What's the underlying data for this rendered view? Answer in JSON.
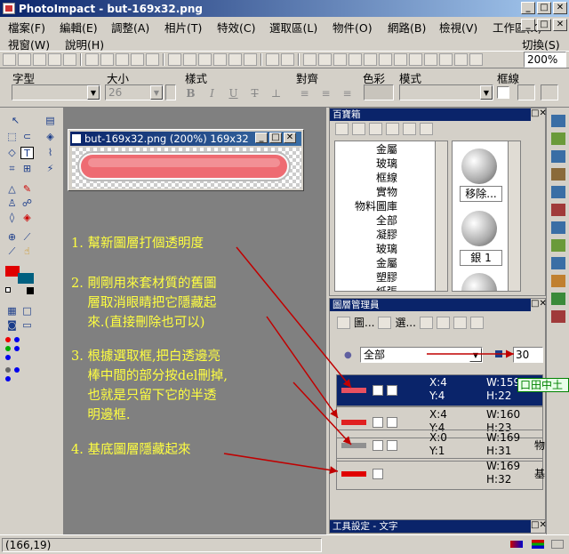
{
  "app": {
    "title": "PhotoImpact - but-169x32.png"
  },
  "menu": {
    "items": [
      "檔案(F)",
      "編輯(E)",
      "調整(A)",
      "相片(T)",
      "特效(C)",
      "選取區(L)",
      "物件(O)",
      "網路(B)",
      "檢視(V)",
      "工作區(K)"
    ],
    "row2": [
      "視窗(W)",
      "說明(H)"
    ],
    "toggle": "切換(S)"
  },
  "toolbar": {
    "zoom": "200%"
  },
  "props": {
    "font_label": "字型",
    "size_label": "大小",
    "style_label": "樣式",
    "align_label": "對齊",
    "color_label": "色彩",
    "mode_label": "模式",
    "border_label": "框線",
    "size_value": "26"
  },
  "document": {
    "title": "but-169x32.png (200%) 169x32",
    "background": "#808080",
    "button_color": "#ee6b72"
  },
  "annotations": [
    "1. 幫新圖層打個透明度",
    "2. 剛剛用來套材質的舊圖\n    層取消眼睛把它隱藏起\n    來.(直接刪除也可以)",
    "3. 根據選取框,把白透邊亮\n    棒中間的部分按del刪掉,\n    也就是只留下它的半透\n    明邊框.",
    "4. 基底圖層隱藏起來"
  ],
  "treasure": {
    "title": "百寶箱",
    "tree": [
      "金屬",
      "玻璃",
      "框線",
      "實物",
      "物料圖庫",
      "全部",
      "凝膠",
      "玻璃",
      "金屬",
      "塑膠",
      "紙張"
    ],
    "thumb_labels": [
      "移除...",
      "銀 1"
    ]
  },
  "layers": {
    "title": "圖層管理員",
    "tab1": "圖...",
    "tab2": "選...",
    "filter": "全部",
    "opacity": "30",
    "rows": [
      {
        "xy": [
          "X:4",
          "Y:4"
        ],
        "wh": [
          "W:159",
          "H:22"
        ],
        "extra": "",
        "swatch": "#e85060"
      },
      {
        "xy": [
          "X:4",
          "Y:4"
        ],
        "wh": [
          "W:160",
          "H:23"
        ],
        "extra": "",
        "swatch": "#e02020"
      },
      {
        "xy": [
          "X:0",
          "Y:1"
        ],
        "wh": [
          "W:169",
          "H:31"
        ],
        "extra": "物",
        "swatch": "#909090"
      },
      {
        "xy": [
          "",
          ""
        ],
        "wh": [
          "W:169",
          "H:32"
        ],
        "extra": "基",
        "swatch": "#e00000"
      }
    ]
  },
  "textpanel": {
    "title": "工具設定 - 文字"
  },
  "ime": {
    "text": "口田中土"
  },
  "status": {
    "coords": "(166,19)"
  },
  "colors": {
    "accent": "#0a246a",
    "note": "#ffff40",
    "fg_swatch": "#e00000",
    "bg_swatch": "#006080"
  }
}
